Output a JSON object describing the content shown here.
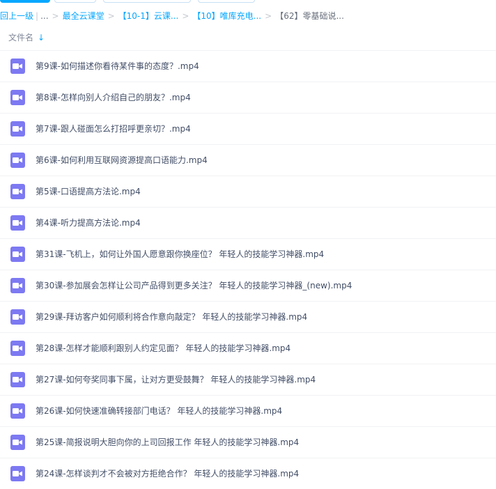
{
  "breadcrumb": {
    "items": [
      {
        "label": "回上一级",
        "kind": "link"
      },
      {
        "label": "|",
        "kind": "pipe"
      },
      {
        "label": "...",
        "kind": "dots"
      },
      {
        "label": ">",
        "kind": "sep"
      },
      {
        "label": "最全云课堂",
        "kind": "link"
      },
      {
        "label": ">",
        "kind": "sep"
      },
      {
        "label": "【10-1】云课...",
        "kind": "link"
      },
      {
        "label": ">",
        "kind": "sep"
      },
      {
        "label": "【10】唯库充电...",
        "kind": "link"
      },
      {
        "label": ">",
        "kind": "sep"
      },
      {
        "label": "【62】零基础说...",
        "kind": "current"
      }
    ]
  },
  "column_header": {
    "label": "文件名",
    "sort_icon": "arrow-down-icon"
  },
  "files": [
    {
      "name": "第9课-如何描述你看待某件事的态度？.mp4",
      "icon": "video-file-icon"
    },
    {
      "name": "第8课-怎样向别人介绍自己的朋友？.mp4",
      "icon": "video-file-icon"
    },
    {
      "name": "第7课-跟人碰面怎么打招呼更亲切？.mp4",
      "icon": "video-file-icon"
    },
    {
      "name": "第6课-如何利用互联网资源提高口语能力.mp4",
      "icon": "video-file-icon"
    },
    {
      "name": "第5课-口语提高方法论.mp4",
      "icon": "video-file-icon"
    },
    {
      "name": "第4课-听力提高方法论.mp4",
      "icon": "video-file-icon"
    },
    {
      "name": "第31课-飞机上，如何让外国人愿意跟你换座位？ 年轻人的技能学习神器.mp4",
      "icon": "video-file-icon"
    },
    {
      "name": "第30课-参加展会怎样让公司产品得到更多关注？ 年轻人的技能学习神器_(new).mp4",
      "icon": "video-file-icon"
    },
    {
      "name": "第29课-拜访客户如何顺利将合作意向敲定？ 年轻人的技能学习神器.mp4",
      "icon": "video-file-icon"
    },
    {
      "name": "第28课-怎样才能顺利跟别人约定见面？ 年轻人的技能学习神器.mp4",
      "icon": "video-file-icon"
    },
    {
      "name": "第27课-如何夸奖同事下属，让对方更受鼓舞？ 年轻人的技能学习神器.mp4",
      "icon": "video-file-icon"
    },
    {
      "name": "第26课-如何快速准确转接部门电话？ 年轻人的技能学习神器.mp4",
      "icon": "video-file-icon"
    },
    {
      "name": "第25课-简报说明大胆向你的上司回报工作 年轻人的技能学习神器.mp4",
      "icon": "video-file-icon"
    },
    {
      "name": "第24课-怎样谈判才不会被对方拒绝合作？ 年轻人的技能学习神器.mp4",
      "icon": "video-file-icon"
    }
  ],
  "colors": {
    "accent": "#06a7ff",
    "video_icon": "#7d79f2",
    "text": "#424e67"
  }
}
